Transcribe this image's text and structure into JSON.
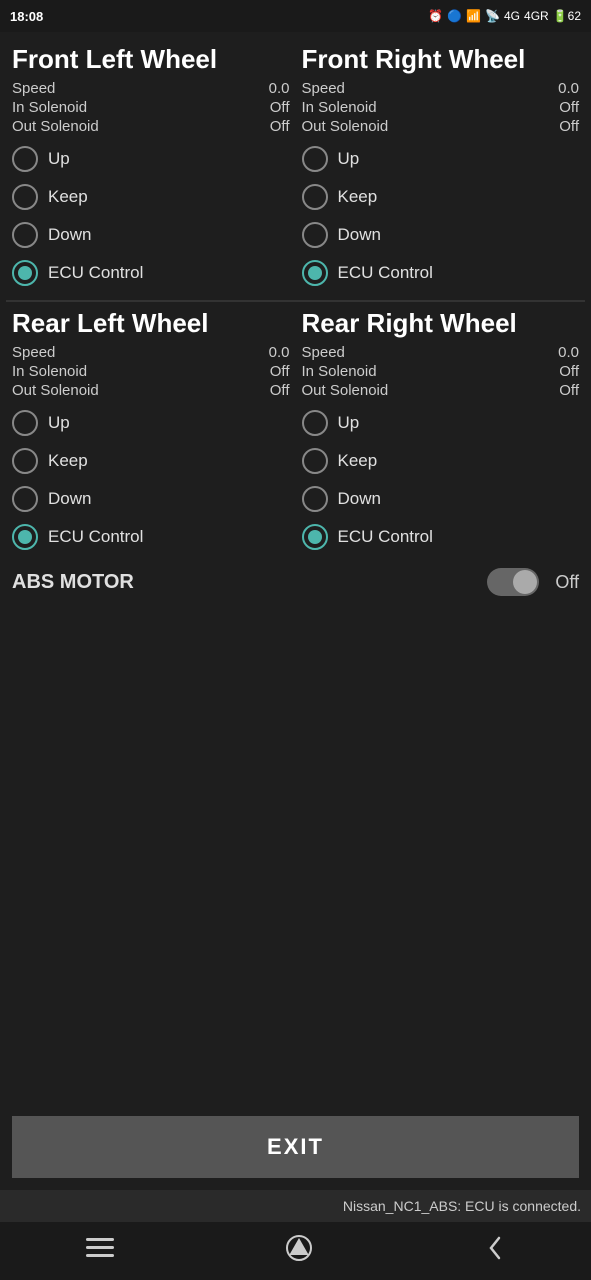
{
  "statusBar": {
    "time": "18:08",
    "rightIcons": "⏰ ☁ 📶 4G 4GR 62%"
  },
  "frontLeft": {
    "title": "Front Left Wheel",
    "speed": "0.0",
    "inSolenoid": "Off",
    "outSolenoid": "Off",
    "options": [
      "Up",
      "Keep",
      "Down",
      "ECU Control"
    ],
    "selected": "ECU Control"
  },
  "frontRight": {
    "title": "Front Right Wheel",
    "speed": "0.0",
    "inSolenoid": "Off",
    "outSolenoid": "Off",
    "options": [
      "Up",
      "Keep",
      "Down",
      "ECU Control"
    ],
    "selected": "ECU Control"
  },
  "rearLeft": {
    "title": "Rear Left Wheel",
    "speed": "0.0",
    "inSolenoid": "Off",
    "outSolenoid": "Off",
    "options": [
      "Up",
      "Keep",
      "Down",
      "ECU Control"
    ],
    "selected": "ECU Control"
  },
  "rearRight": {
    "title": "Rear Right Wheel",
    "speed": "0.0",
    "inSolenoid": "Off",
    "outSolenoid": "Off",
    "options": [
      "Up",
      "Keep",
      "Down",
      "ECU Control"
    ],
    "selected": "ECU Control"
  },
  "absMotor": {
    "label": "ABS MOTOR",
    "value": "Off",
    "enabled": false
  },
  "exitButton": "EXIT",
  "ecuStatus": "Nissan_NC1_ABS: ECU is connected.",
  "labels": {
    "speed": "Speed",
    "inSolenoid": "In Solenoid",
    "outSolenoid": "Out Solenoid"
  }
}
